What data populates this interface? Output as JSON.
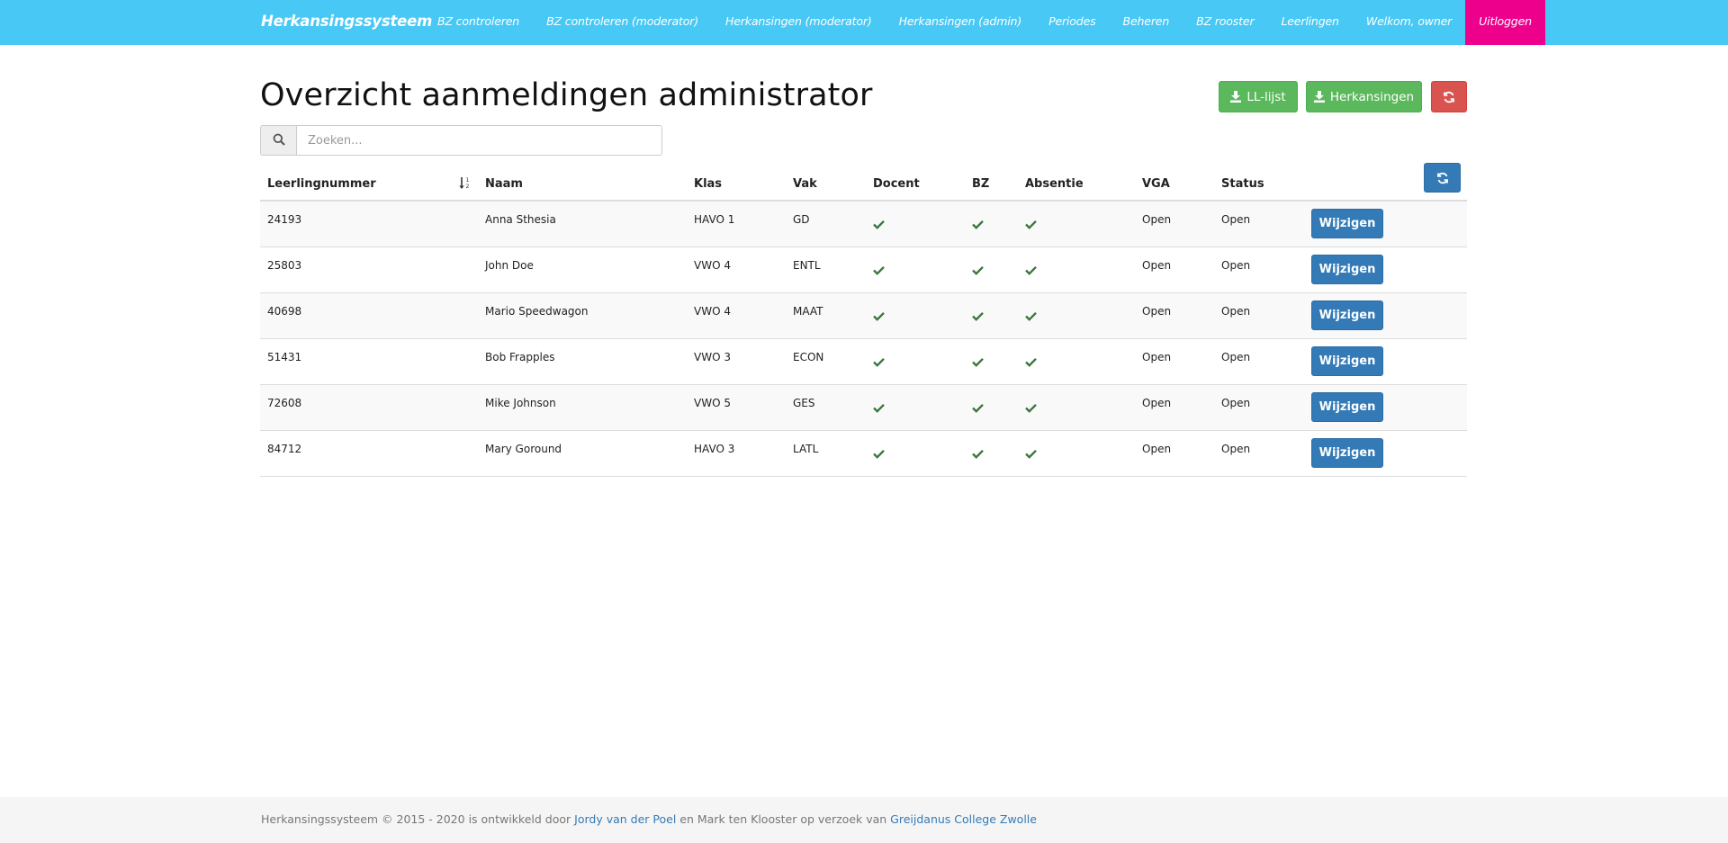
{
  "navbar": {
    "brand": "Herkansingssysteem",
    "items": [
      {
        "label": "BZ controleren"
      },
      {
        "label": "BZ controleren (moderator)"
      },
      {
        "label": "Herkansingen (moderator)"
      },
      {
        "label": "Herkansingen (admin)"
      },
      {
        "label": "Periodes"
      },
      {
        "label": "Beheren"
      },
      {
        "label": "BZ rooster"
      },
      {
        "label": "Leerlingen"
      },
      {
        "label": "Welkom, owner"
      }
    ],
    "logout_label": "Uitloggen",
    "colors": {
      "bar": "#48c8f4",
      "logout": "#ec008c"
    }
  },
  "header": {
    "title": "Overzicht aanmeldingen administrator",
    "ll_button_label": "LL-lijst",
    "herkansingen_button_label": "Herkansingen",
    "download_icon": "download-icon",
    "refresh_icon": "refresh-icon"
  },
  "search": {
    "placeholder": "Zoeken...",
    "value": "",
    "icon": "search-icon"
  },
  "table": {
    "columns": [
      "Leerlingnummer",
      "Naam",
      "Klas",
      "Vak",
      "Docent",
      "BZ",
      "Absentie",
      "VGA",
      "Status"
    ],
    "sort_icon": "sort-numeric-asc-icon",
    "check_color": "#3c763d",
    "action_label": "Wijzigen",
    "rows": [
      {
        "nummer": "24193",
        "naam": "Anna Sthesia",
        "klas": "HAVO 1",
        "vak": "GD",
        "docent": true,
        "bz": true,
        "absentie": true,
        "vga": "Open",
        "status": "Open"
      },
      {
        "nummer": "25803",
        "naam": "John Doe",
        "klas": "VWO 4",
        "vak": "ENTL",
        "docent": true,
        "bz": true,
        "absentie": true,
        "vga": "Open",
        "status": "Open"
      },
      {
        "nummer": "40698",
        "naam": "Mario Speedwagon",
        "klas": "VWO 4",
        "vak": "MAAT",
        "docent": true,
        "bz": true,
        "absentie": true,
        "vga": "Open",
        "status": "Open"
      },
      {
        "nummer": "51431",
        "naam": "Bob Frapples",
        "klas": "VWO 3",
        "vak": "ECON",
        "docent": true,
        "bz": true,
        "absentie": true,
        "vga": "Open",
        "status": "Open"
      },
      {
        "nummer": "72608",
        "naam": "Mike Johnson",
        "klas": "VWO 5",
        "vak": "GES",
        "docent": true,
        "bz": true,
        "absentie": true,
        "vga": "Open",
        "status": "Open"
      },
      {
        "nummer": "84712",
        "naam": "Mary Goround",
        "klas": "HAVO 3",
        "vak": "LATL",
        "docent": true,
        "bz": true,
        "absentie": true,
        "vga": "Open",
        "status": "Open"
      }
    ]
  },
  "footer": {
    "prefix": "Herkansingssysteem © 2015 - 2020 is ontwikkeld door ",
    "author1": "Jordy van der Poel",
    "middle": " en Mark ten Klooster op verzoek van ",
    "school": "Greijdanus College Zwolle"
  }
}
